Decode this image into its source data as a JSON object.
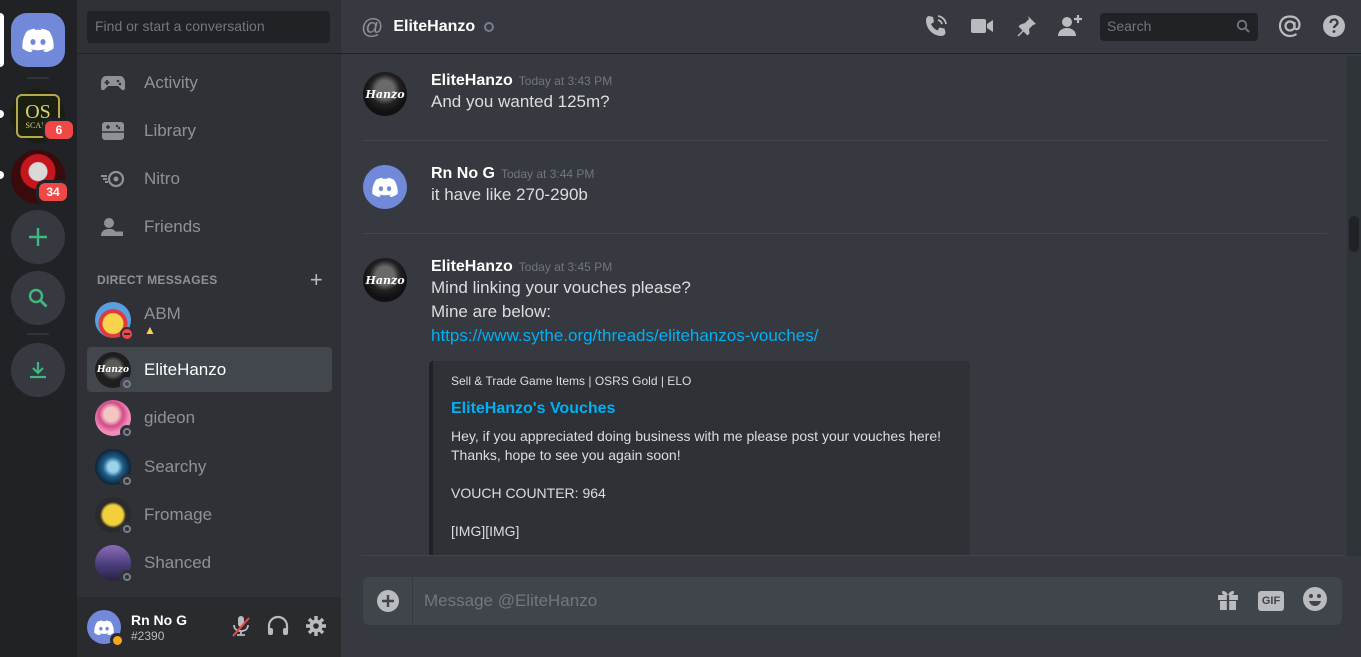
{
  "rail": {
    "osrs_badge": "6",
    "osrs_text": "OS",
    "osrs_sub": "SCAPE",
    "red_badge": "34"
  },
  "sidebar": {
    "search_placeholder": "Find or start a conversation",
    "nav": [
      {
        "label": "Activity",
        "icon": "gamepad-icon"
      },
      {
        "label": "Library",
        "icon": "library-icon"
      },
      {
        "label": "Nitro",
        "icon": "nitro-icon"
      },
      {
        "label": "Friends",
        "icon": "friends-icon"
      }
    ],
    "dm_header": "DIRECT MESSAGES",
    "dm_add": "+",
    "dms": [
      {
        "name": "ABM"
      },
      {
        "name": "EliteHanzo"
      },
      {
        "name": "gideon"
      },
      {
        "name": "Searchy"
      },
      {
        "name": "Fromage"
      },
      {
        "name": "Shanced"
      }
    ]
  },
  "user": {
    "name": "Rn No G",
    "discriminator": "#2390"
  },
  "header": {
    "at": "@",
    "title": "EliteHanzo",
    "search_placeholder": "Search"
  },
  "messages": [
    {
      "author": "EliteHanzo",
      "timestamp": "Today at 3:43 PM",
      "lines": [
        "And you wanted 125m?"
      ]
    },
    {
      "author": "Rn No G",
      "timestamp": "Today at 3:44 PM",
      "lines": [
        "it have like 270-290b"
      ]
    },
    {
      "author": "EliteHanzo",
      "timestamp": "Today at 3:45 PM",
      "lines": [
        "Mind linking your vouches please?",
        "Mine are below:"
      ],
      "link": "https://www.sythe.org/threads/elitehanzos-vouches/"
    }
  ],
  "avatar_text": "Hanzo",
  "embed": {
    "provider": "Sell & Trade Game Items | OSRS Gold | ELO",
    "title": "EliteHanzo's Vouches",
    "description": "Hey, if you appreciated doing business with me please post your vouches here!\nThanks, hope to see you again soon!\n\nVOUCH COUNTER: 964\n\n[IMG][IMG]"
  },
  "composer": {
    "placeholder": "Message @EliteHanzo",
    "gif_label": "GIF"
  },
  "colors": {
    "blurple": "#7289da",
    "green": "#43b581",
    "red": "#f04747",
    "link": "#00b0f4"
  }
}
